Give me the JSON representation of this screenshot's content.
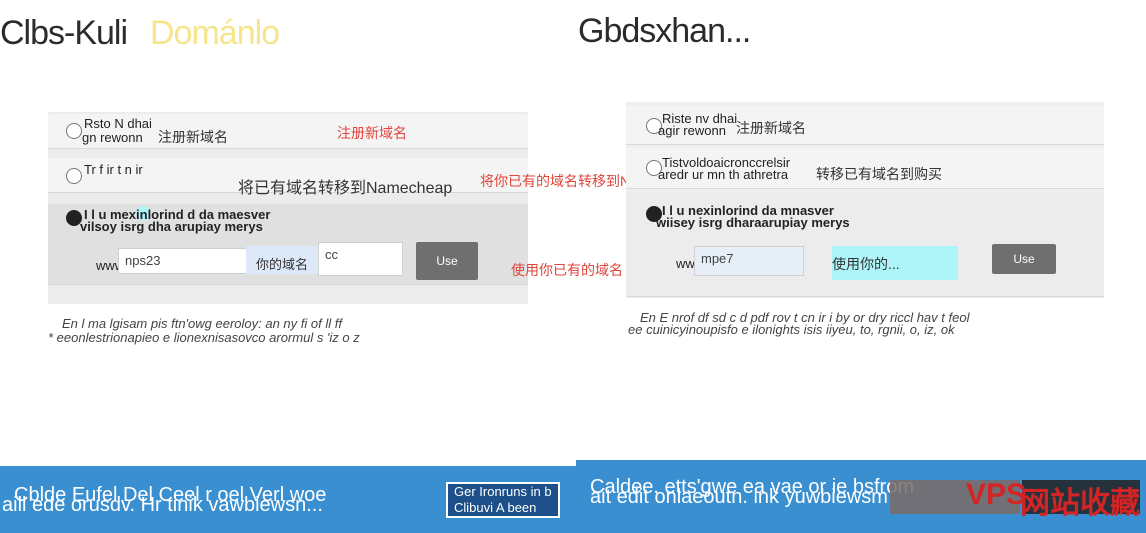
{
  "left": {
    "title": "Clbs-Kuli",
    "title_ghost": "Dománlo",
    "options": [
      {
        "label_line1": "Rsto N dhai",
        "label_line2": "gn rewonn",
        "cn": "注册新域名",
        "anno": "注册新域名"
      },
      {
        "label_line1": "Tr f  ir t  n  ir",
        "label_line2": "",
        "cn": "转移到Namecheap",
        "anno": "将你已有的域名转移到Namecheap来管理",
        "cn2": "将已有域名转移到Namecheap"
      },
      {
        "label_line1": "I l u mexinlorind d da maesver",
        "label_line2": "vilsoy isrg dha arupiay merys",
        "anno": "使用你已有的域名"
      }
    ],
    "www": "www",
    "domain_value": "nps23",
    "domain_overlay": "你的域名",
    "tld": "cc",
    "use_button": "Use",
    "footnote_line1": "En l ma lgisam  pis ftn'owg eeroloy: an ny fi  of  ll  ff",
    "footnote_line2": "* eeonlestrionapieo e lionexnisasovco  arormul s 'iz o z"
  },
  "right": {
    "title": "Gbdsxhan...",
    "options": [
      {
        "label_line1": "Riste nv dhai",
        "label_line2": "agir rewonn",
        "cn": "注册新域名"
      },
      {
        "label_line1": "Tistvoldoaicronccrelsir",
        "label_line2": "aredr ur mn th athretra",
        "cn": "转移已有域名到购买"
      },
      {
        "label_line1": "I l u nexinlorind da mnasver",
        "label_line2": "wiisey isrg dharaarupiay merys"
      }
    ],
    "www": "www",
    "domain_value": "mpe7",
    "domain_overlay": "使用你的...",
    "use_button": "Use",
    "footnote_line1": "En E nrof df  sd   c  d pdf  rov t cn ir  i by or dry riccl hav  t feol",
    "footnote_line2": "ee cuinicyinoupisfo e ilonights isis iiyeu, to, rgnii, o, iz, ok"
  },
  "banner": {
    "left_line1": "Cblde Eufel Del Ceel r oel Verl woe",
    "left_line2": "aill ede orusdv. Hr tinik vawbiewsn...",
    "left_btn_line1": "Ger Ironruns in b",
    "left_btn_line2": "Clibuvi A been",
    "right_line1": "Caldee. etts'gwe ea  vae or ie bsfrom",
    "right_line2": "ait edit onlaeoutn. ink yuwbiewsm"
  },
  "watermark": {
    "vps": "VPS",
    "cn": "网站收藏"
  }
}
